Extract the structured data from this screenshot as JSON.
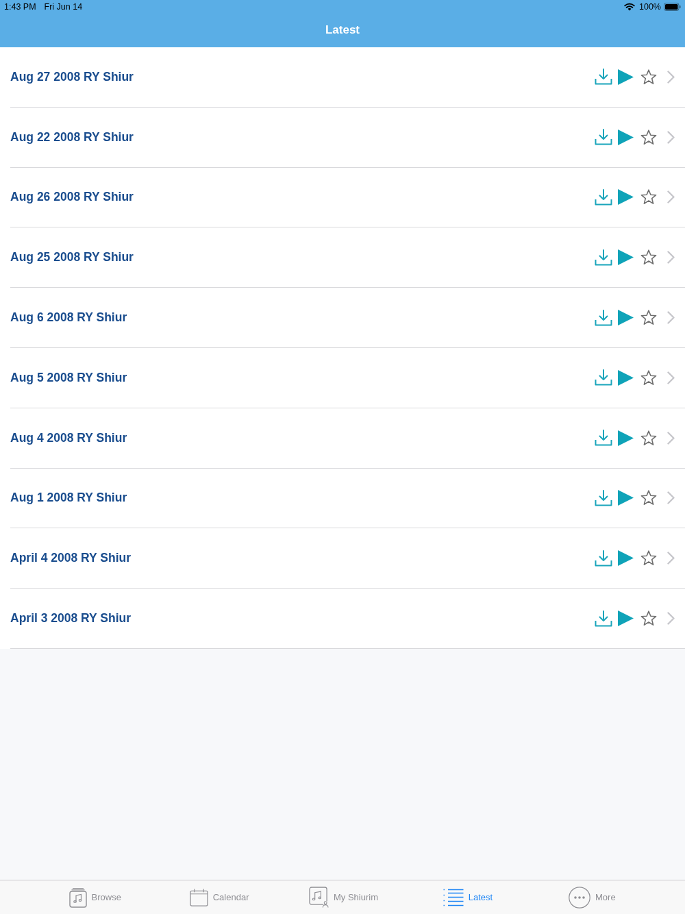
{
  "status_bar": {
    "time": "1:43 PM",
    "date": "Fri Jun 14",
    "battery": "100%"
  },
  "nav_bar": {
    "title": "Latest"
  },
  "rows": [
    {
      "title": "Aug 27 2008 RY Shiur",
      "favorite": false
    },
    {
      "title": "Aug 22 2008 RY Shiur",
      "favorite": false
    },
    {
      "title": "Aug 26 2008 RY Shiur",
      "favorite": false
    },
    {
      "title": "Aug 25 2008 RY Shiur",
      "favorite": false
    },
    {
      "title": "Aug 6 2008 RY Shiur",
      "favorite": false
    },
    {
      "title": "Aug 5 2008 RY Shiur",
      "favorite": false
    },
    {
      "title": "Aug 4 2008 RY Shiur",
      "favorite": false
    },
    {
      "title": "Aug 1 2008 RY Shiur",
      "favorite": false
    },
    {
      "title": "April 4 2008 RY Shiur",
      "favorite": false
    },
    {
      "title": "April 3 2008 RY Shiur",
      "favorite": false
    }
  ],
  "tab_bar": [
    {
      "label": "Browse",
      "kind": "browse",
      "selected": false
    },
    {
      "label": "Calendar",
      "kind": "calendar",
      "selected": false
    },
    {
      "label": "My Shiurim",
      "kind": "my",
      "selected": false
    },
    {
      "label": "Latest",
      "kind": "latest",
      "selected": true
    },
    {
      "label": "More",
      "kind": "more",
      "selected": false
    }
  ]
}
